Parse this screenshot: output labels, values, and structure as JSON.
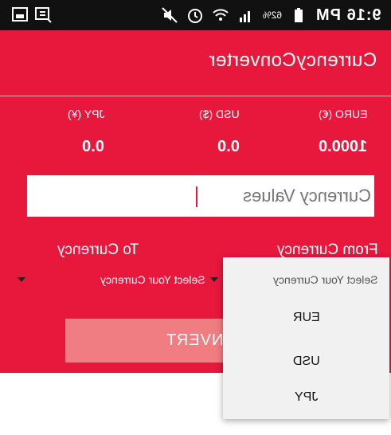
{
  "status_bar": {
    "time": "9:16 PM",
    "battery": "62%"
  },
  "app_bar": {
    "title": "CurrencyConverter"
  },
  "rates": [
    {
      "label": "EURO (€)",
      "value": "1000.0"
    },
    {
      "label": "USD ($)",
      "value": "0.0"
    },
    {
      "label": "JPY (¥)",
      "value": "0.0"
    }
  ],
  "input": {
    "placeholder": "Currency Values"
  },
  "from_currency": {
    "label": "From Currency"
  },
  "to_currency": {
    "label": "To Currency",
    "selected": "Select Your Currency"
  },
  "convert_button": {
    "label": "CONVERT"
  },
  "dropdown": {
    "header": "Select Your Currency",
    "options": [
      "EUR",
      "USD",
      "JPY"
    ]
  },
  "colors": {
    "primary": "#e8173c",
    "button": "#ef7d82",
    "status_bar": "#111111",
    "popup": "#f1f1f1"
  }
}
